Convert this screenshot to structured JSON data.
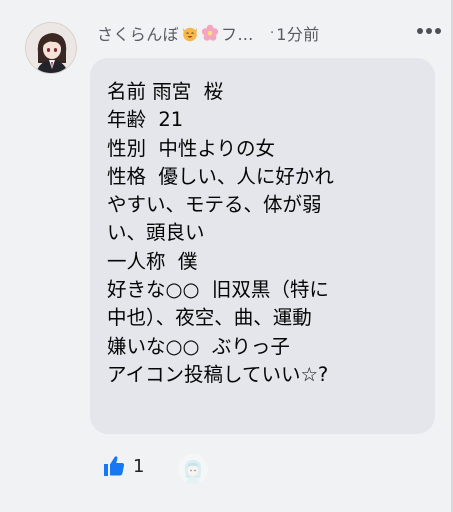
{
  "comment": {
    "author_name": "さくらんぼ",
    "author_emojis": [
      "cat-face-icon",
      "cherry-blossom-icon"
    ],
    "truncated_suffix": "フ…",
    "separator": "·",
    "time": "1分前",
    "body_lines": [
      "名前 雨宮  桜",
      "年齢  21",
      "性別  中性よりの女",
      "性格  優しい、人に好かれ",
      "やすい、モテる、体が弱",
      "い、頭良い",
      "一人称  僕",
      "好きな○○  旧双黒（特に",
      "中也）、夜空、曲、運動",
      "嫌いな○○  ぶりっ子",
      "アイコン投稿していい☆?"
    ]
  },
  "reactions": {
    "like_count": "1"
  },
  "colors": {
    "background": "#f1f2f4",
    "bubble": "#e4e6eb",
    "like_blue": "#1877f2",
    "text": "#050505",
    "meta_text": "#575c63"
  }
}
